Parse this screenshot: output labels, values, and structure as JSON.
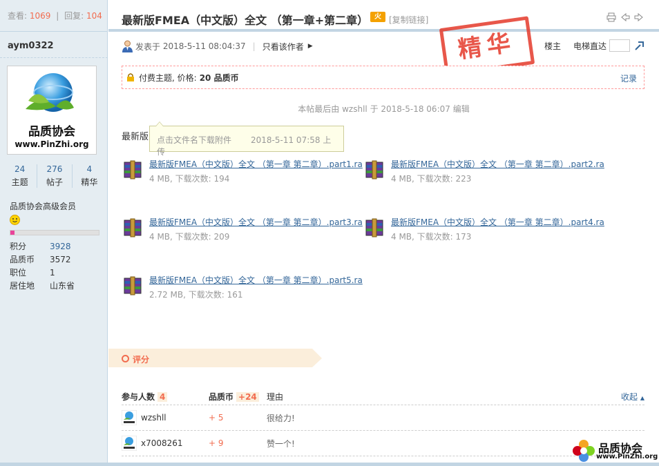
{
  "sidebar": {
    "views_label": "查看:",
    "views": "1069",
    "replies_label": "回复:",
    "replies": "104",
    "username": "aym0322",
    "avatar": {
      "logo_text": "品质协会",
      "logo_url": "www.PinZhi.org"
    },
    "counts": [
      {
        "value": "24",
        "label": "主题"
      },
      {
        "value": "276",
        "label": "帖子"
      },
      {
        "value": "4",
        "label": "精华"
      }
    ],
    "group": "品质协会高级会员",
    "level_progress": 0.05,
    "fields": [
      {
        "label": "积分",
        "value": "3928",
        "link": true
      },
      {
        "label": "品质币",
        "value": "3572",
        "link": false
      },
      {
        "label": "职位",
        "value": "1",
        "link": false
      },
      {
        "label": "居住地",
        "value": "山东省",
        "link": false
      }
    ]
  },
  "header": {
    "title": "最新版FMEA（中文版）全文 （第一章+第二章）",
    "copy_link": "[复制链接]",
    "hot_label": "火"
  },
  "post": {
    "posted_prefix": "发表于",
    "posted_at": "2018-5-11 08:04:37",
    "author_only": "只看该作者",
    "floor_owner": "楼主",
    "elevator": "电梯直达",
    "stamp": "精华",
    "paid_text": "付费主题, 价格:",
    "paid_price": "20 品质币",
    "record": "记录",
    "edit_note": "本帖最后由 wzshll 于 2018-5-18 06:07 编辑",
    "body_text": "最新版",
    "tooltip": {
      "hint": "点击文件名下载附件",
      "uploaded": "2018-5-11 07:58 上传"
    }
  },
  "attachments": [
    {
      "name": "最新版FMEA（中文版）全文 （第一章 第二章）.part1.ra",
      "meta": "4 MB, 下载次数: 194"
    },
    {
      "name": "最新版FMEA（中文版）全文 （第一章 第二章）.part2.ra",
      "meta": "4 MB, 下载次数: 223"
    },
    {
      "name": "最新版FMEA（中文版）全文 （第一章 第二章）.part3.ra",
      "meta": "4 MB, 下载次数: 209"
    },
    {
      "name": "最新版FMEA（中文版）全文 （第一章 第二章）.part4.ra",
      "meta": "4 MB, 下载次数: 173"
    },
    {
      "name": "最新版FMEA（中文版）全文 （第一章 第二章）.part5.ra",
      "meta": "2.72 MB, 下载次数: 161"
    }
  ],
  "rating": {
    "title": "评分",
    "participants_label": "参与人数",
    "participants": "4",
    "coin_label": "品质币",
    "coin_total": "+24",
    "reason_label": "理由",
    "collapse": "收起",
    "rows": [
      {
        "user": "wzshll",
        "coin": "+ 5",
        "reason": "很给力!"
      },
      {
        "user": "x7008261",
        "coin": "+ 9",
        "reason": "赞一个!"
      }
    ]
  },
  "watermark": {
    "text": "品质协会",
    "url": "www.PinZhi.org"
  },
  "colors": {
    "accent": "#f26c4f",
    "link": "#336699",
    "sidebar_bg": "#e5edf2",
    "stamp": "#e43a2b"
  }
}
